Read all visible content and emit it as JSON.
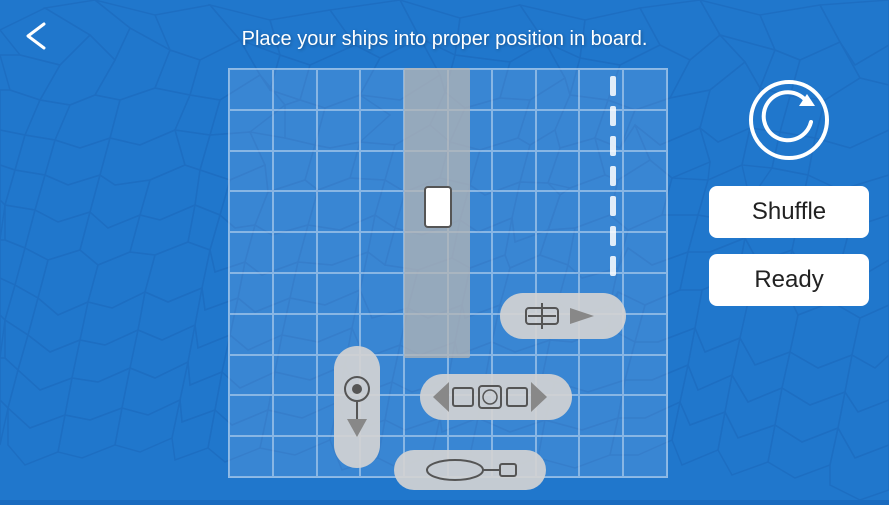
{
  "app": {
    "instruction": "Place your ships into proper position in board.",
    "back_label": "←"
  },
  "controls": {
    "rotate_label": "↻",
    "shuffle_label": "Shuffle",
    "ready_label": "Ready"
  },
  "board": {
    "cols": 10,
    "rows": 10
  },
  "colors": {
    "background": "#1e74cc",
    "board_bg": "rgba(30,100,200,0.3)",
    "ship_fill": "rgba(210,210,210,0.92)",
    "button_bg": "#ffffff",
    "button_text": "#222222",
    "text_color": "#ffffff"
  }
}
